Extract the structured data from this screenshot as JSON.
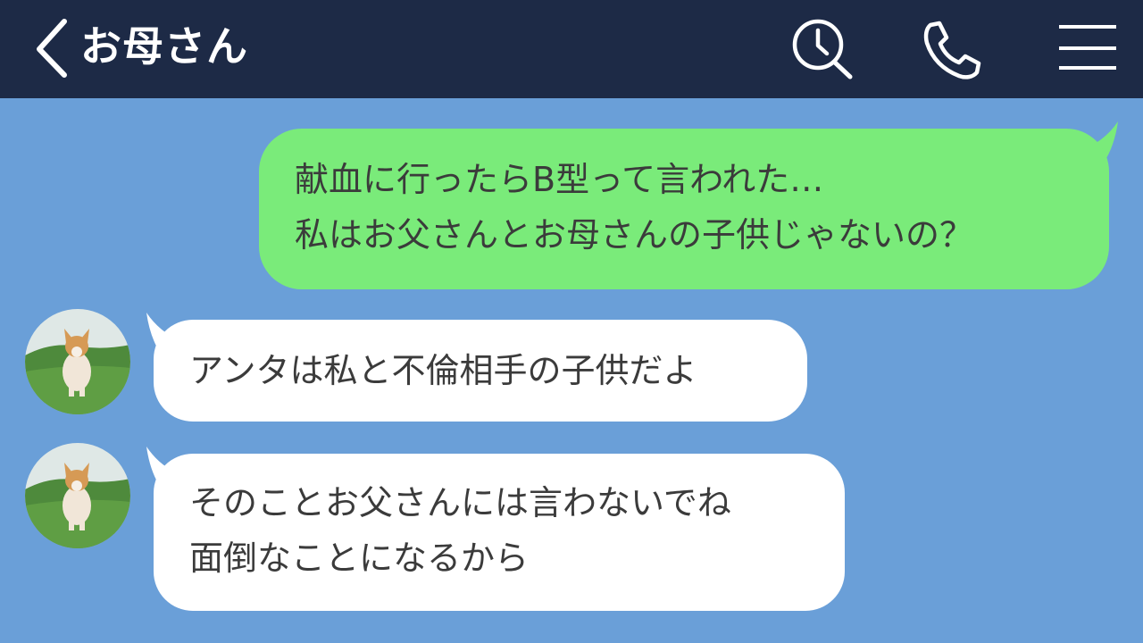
{
  "header": {
    "title": "お母さん",
    "icons": [
      "back-arrow-icon",
      "search-icon",
      "phone-icon",
      "menu-icon"
    ],
    "background_color": "#1d2a46"
  },
  "chat": {
    "background_color": "#6a9fd8",
    "messages": [
      {
        "direction": "sent",
        "bubble_color": "#7aeb7a",
        "lines": [
          "献血に行ったらB型って言われた…",
          "私はお父さんとお母さんの子供じゃないの？"
        ]
      },
      {
        "direction": "received",
        "bubble_color": "#ffffff",
        "avatar": "corgi-avatar",
        "lines": [
          "アンタは私と不倫相手の子供だよ"
        ]
      },
      {
        "direction": "received",
        "bubble_color": "#ffffff",
        "avatar": "corgi-avatar",
        "lines": [
          "そのことお父さんには言わないでね",
          "面倒なことになるから"
        ]
      }
    ]
  }
}
